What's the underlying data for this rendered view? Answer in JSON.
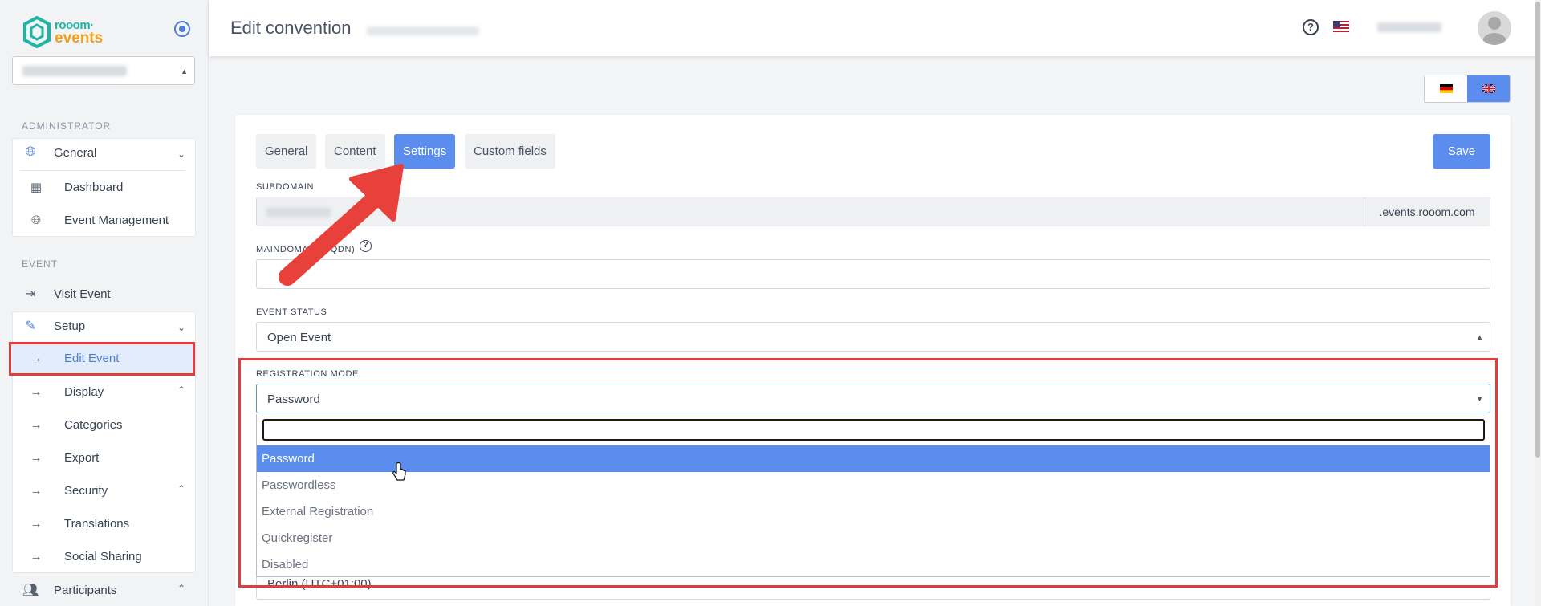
{
  "sidebar": {
    "logo_line1": "rooom·",
    "logo_line2": "events",
    "section_admin": "ADMINISTRATOR",
    "section_event": "EVENT",
    "general": "General",
    "dashboard": "Dashboard",
    "event_management": "Event Management",
    "visit_event": "Visit Event",
    "setup": "Setup",
    "edit_event": "Edit Event",
    "display": "Display",
    "categories": "Categories",
    "export": "Export",
    "security": "Security",
    "translations": "Translations",
    "social_sharing": "Social Sharing",
    "participants": "Participants"
  },
  "header": {
    "title": "Edit convention",
    "help_symbol": "?"
  },
  "tabs": [
    "General",
    "Content",
    "Settings",
    "Custom fields"
  ],
  "active_tab": "Settings",
  "save_label": "Save",
  "fields": {
    "subdomain_label": "SUBDOMAIN",
    "subdomain_suffix": ".events.rooom.com",
    "maindomain_label": "MAINDOMAIN (FQDN)",
    "event_status_label": "EVENT STATUS",
    "event_status_value": "Open Event",
    "registration_mode_label": "REGISTRATION MODE",
    "registration_mode_value": "Password",
    "timezone_value": "Berlin (UTC+01:00)"
  },
  "registration_options": [
    "Password",
    "Passwordless",
    "External Registration",
    "Quickregister",
    "Disabled"
  ],
  "colors": {
    "accent": "#5b8def",
    "highlight": "#e23d3d",
    "brand_teal": "#1fb5a5",
    "brand_orange": "#f0a11c"
  }
}
